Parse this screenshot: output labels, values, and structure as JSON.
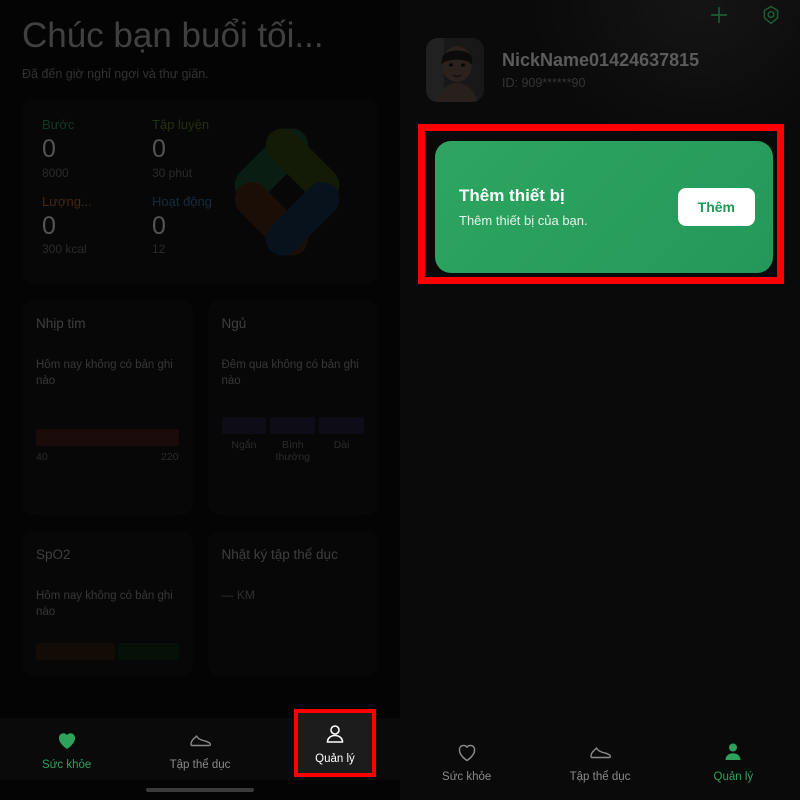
{
  "left_panel": {
    "greeting": {
      "title": "Chúc bạn buổi tối...",
      "subtitle": "Đã đến giờ nghỉ ngơi và thư giãn."
    },
    "stats": [
      {
        "label": "Bước",
        "value": "0",
        "goal": "8000",
        "color": "#2f7a4e"
      },
      {
        "label": "Tập luyện",
        "value": "0",
        "goal": "30 phút",
        "color": "#4d6b2a"
      },
      {
        "label": "Lượng...",
        "value": "0",
        "goal": "300 kcal",
        "color": "#9c5526"
      },
      {
        "label": "Hoạt động",
        "value": "0",
        "goal": "12",
        "color": "#2f5f8f"
      }
    ],
    "logo_colors": {
      "top_left": "#16402c",
      "top_right": "#2b3d11",
      "bottom_left": "#3b2011",
      "bottom_right": "#13283f"
    },
    "cards": {
      "heart_rate": {
        "title": "Nhịp tim",
        "note": "Hôm nay không có bản ghi nào",
        "scale_min": "40",
        "scale_max": "220"
      },
      "sleep": {
        "title": "Ngủ",
        "note": "Đêm qua không có bản ghi nào",
        "segments": [
          "Ngắn",
          "Bình thường",
          "Dài"
        ]
      },
      "spo2": {
        "title": "SpO2",
        "note": "Hôm nay không có bản ghi nào"
      },
      "exercise_log": {
        "title": "Nhật ký tập thể dục",
        "distance": "— KM"
      }
    },
    "nav": [
      {
        "label": "Sức khỏe",
        "icon": "heart-filled-icon",
        "active": true
      },
      {
        "label": "Tập thể dục",
        "icon": "shoe-icon",
        "active": false
      },
      {
        "label": "Quản lý",
        "icon": "person-icon",
        "active": false
      }
    ]
  },
  "right_panel": {
    "top_icons": [
      {
        "name": "add-icon"
      },
      {
        "name": "scan-hexagon-icon"
      }
    ],
    "profile": {
      "name": "NickName01424637815",
      "id": "ID: 909******90"
    },
    "add_device": {
      "title": "Thêm thiết bị",
      "subtitle": "Thêm thiết bị của bạn.",
      "button_label": "Thêm"
    },
    "nav": [
      {
        "label": "Sức khỏe",
        "icon": "heart-outline-icon",
        "active": false
      },
      {
        "label": "Tập thể dục",
        "icon": "shoe-icon",
        "active": false
      },
      {
        "label": "Quản lý",
        "icon": "person-filled-icon",
        "active": true
      }
    ]
  },
  "accents": {
    "green": "#2fa15c",
    "highlight_red": "#ff0000",
    "inactive_gray": "#8a8a8a"
  }
}
